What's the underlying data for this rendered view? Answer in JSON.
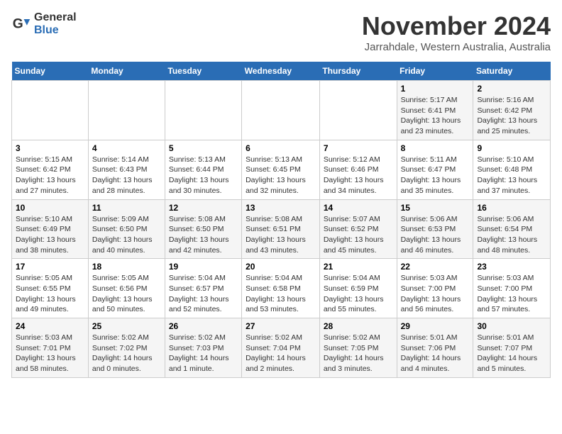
{
  "logo": {
    "general": "General",
    "blue": "Blue"
  },
  "title": "November 2024",
  "subtitle": "Jarrahdale, Western Australia, Australia",
  "header_days": [
    "Sunday",
    "Monday",
    "Tuesday",
    "Wednesday",
    "Thursday",
    "Friday",
    "Saturday"
  ],
  "weeks": [
    [
      {
        "day": "",
        "detail": ""
      },
      {
        "day": "",
        "detail": ""
      },
      {
        "day": "",
        "detail": ""
      },
      {
        "day": "",
        "detail": ""
      },
      {
        "day": "",
        "detail": ""
      },
      {
        "day": "1",
        "detail": "Sunrise: 5:17 AM\nSunset: 6:41 PM\nDaylight: 13 hours\nand 23 minutes."
      },
      {
        "day": "2",
        "detail": "Sunrise: 5:16 AM\nSunset: 6:42 PM\nDaylight: 13 hours\nand 25 minutes."
      }
    ],
    [
      {
        "day": "3",
        "detail": "Sunrise: 5:15 AM\nSunset: 6:42 PM\nDaylight: 13 hours\nand 27 minutes."
      },
      {
        "day": "4",
        "detail": "Sunrise: 5:14 AM\nSunset: 6:43 PM\nDaylight: 13 hours\nand 28 minutes."
      },
      {
        "day": "5",
        "detail": "Sunrise: 5:13 AM\nSunset: 6:44 PM\nDaylight: 13 hours\nand 30 minutes."
      },
      {
        "day": "6",
        "detail": "Sunrise: 5:13 AM\nSunset: 6:45 PM\nDaylight: 13 hours\nand 32 minutes."
      },
      {
        "day": "7",
        "detail": "Sunrise: 5:12 AM\nSunset: 6:46 PM\nDaylight: 13 hours\nand 34 minutes."
      },
      {
        "day": "8",
        "detail": "Sunrise: 5:11 AM\nSunset: 6:47 PM\nDaylight: 13 hours\nand 35 minutes."
      },
      {
        "day": "9",
        "detail": "Sunrise: 5:10 AM\nSunset: 6:48 PM\nDaylight: 13 hours\nand 37 minutes."
      }
    ],
    [
      {
        "day": "10",
        "detail": "Sunrise: 5:10 AM\nSunset: 6:49 PM\nDaylight: 13 hours\nand 38 minutes."
      },
      {
        "day": "11",
        "detail": "Sunrise: 5:09 AM\nSunset: 6:50 PM\nDaylight: 13 hours\nand 40 minutes."
      },
      {
        "day": "12",
        "detail": "Sunrise: 5:08 AM\nSunset: 6:50 PM\nDaylight: 13 hours\nand 42 minutes."
      },
      {
        "day": "13",
        "detail": "Sunrise: 5:08 AM\nSunset: 6:51 PM\nDaylight: 13 hours\nand 43 minutes."
      },
      {
        "day": "14",
        "detail": "Sunrise: 5:07 AM\nSunset: 6:52 PM\nDaylight: 13 hours\nand 45 minutes."
      },
      {
        "day": "15",
        "detail": "Sunrise: 5:06 AM\nSunset: 6:53 PM\nDaylight: 13 hours\nand 46 minutes."
      },
      {
        "day": "16",
        "detail": "Sunrise: 5:06 AM\nSunset: 6:54 PM\nDaylight: 13 hours\nand 48 minutes."
      }
    ],
    [
      {
        "day": "17",
        "detail": "Sunrise: 5:05 AM\nSunset: 6:55 PM\nDaylight: 13 hours\nand 49 minutes."
      },
      {
        "day": "18",
        "detail": "Sunrise: 5:05 AM\nSunset: 6:56 PM\nDaylight: 13 hours\nand 50 minutes."
      },
      {
        "day": "19",
        "detail": "Sunrise: 5:04 AM\nSunset: 6:57 PM\nDaylight: 13 hours\nand 52 minutes."
      },
      {
        "day": "20",
        "detail": "Sunrise: 5:04 AM\nSunset: 6:58 PM\nDaylight: 13 hours\nand 53 minutes."
      },
      {
        "day": "21",
        "detail": "Sunrise: 5:04 AM\nSunset: 6:59 PM\nDaylight: 13 hours\nand 55 minutes."
      },
      {
        "day": "22",
        "detail": "Sunrise: 5:03 AM\nSunset: 7:00 PM\nDaylight: 13 hours\nand 56 minutes."
      },
      {
        "day": "23",
        "detail": "Sunrise: 5:03 AM\nSunset: 7:00 PM\nDaylight: 13 hours\nand 57 minutes."
      }
    ],
    [
      {
        "day": "24",
        "detail": "Sunrise: 5:03 AM\nSunset: 7:01 PM\nDaylight: 13 hours\nand 58 minutes."
      },
      {
        "day": "25",
        "detail": "Sunrise: 5:02 AM\nSunset: 7:02 PM\nDaylight: 14 hours\nand 0 minutes."
      },
      {
        "day": "26",
        "detail": "Sunrise: 5:02 AM\nSunset: 7:03 PM\nDaylight: 14 hours\nand 1 minute."
      },
      {
        "day": "27",
        "detail": "Sunrise: 5:02 AM\nSunset: 7:04 PM\nDaylight: 14 hours\nand 2 minutes."
      },
      {
        "day": "28",
        "detail": "Sunrise: 5:02 AM\nSunset: 7:05 PM\nDaylight: 14 hours\nand 3 minutes."
      },
      {
        "day": "29",
        "detail": "Sunrise: 5:01 AM\nSunset: 7:06 PM\nDaylight: 14 hours\nand 4 minutes."
      },
      {
        "day": "30",
        "detail": "Sunrise: 5:01 AM\nSunset: 7:07 PM\nDaylight: 14 hours\nand 5 minutes."
      }
    ]
  ]
}
